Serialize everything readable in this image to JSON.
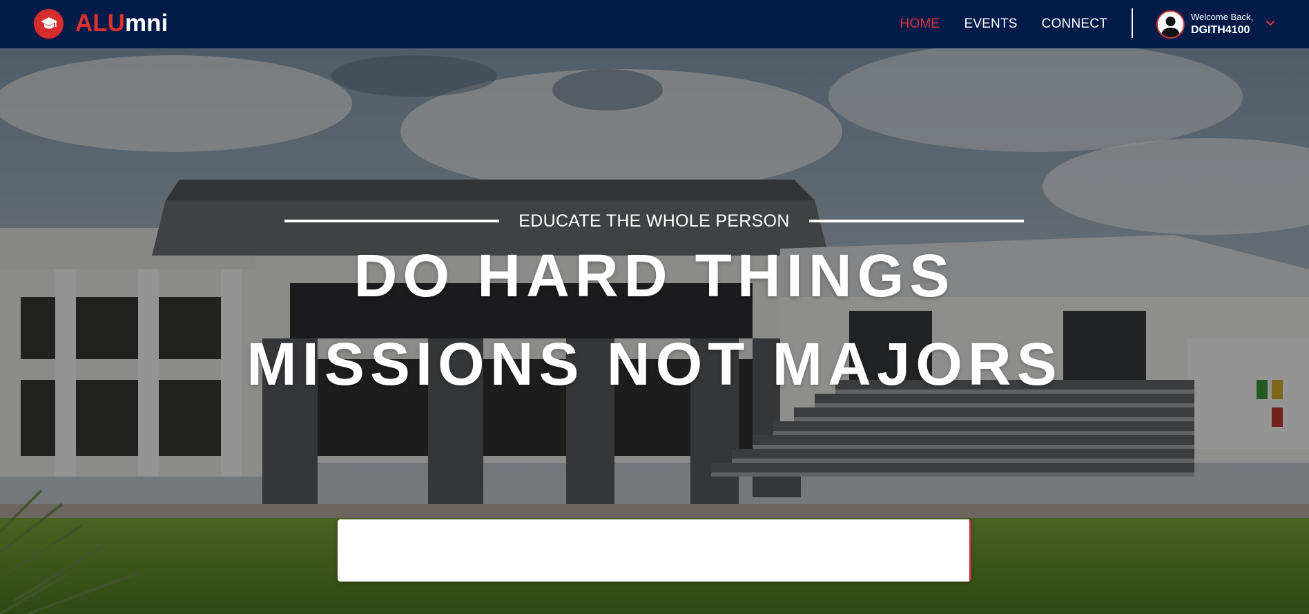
{
  "brand": {
    "logo_icon": "graduation-cap-icon",
    "name_part1": "ALU",
    "name_part2": "mni",
    "accent_color": "#e03131"
  },
  "nav": {
    "items": [
      {
        "label": "HOME",
        "active": true
      },
      {
        "label": "EVENTS",
        "active": false
      },
      {
        "label": "CONNECT",
        "active": false
      }
    ],
    "background_color": "#021b48",
    "active_color": "#d9373f"
  },
  "user": {
    "avatar_icon": "user-avatar-icon",
    "welcome": "Welcome Back,",
    "username": "DGITH4100",
    "menu_icon": "chevron-down-icon"
  },
  "hero": {
    "tagline": "EDUCATE THE WHOLE PERSON",
    "headline_line1": "DO HARD THINGS",
    "headline_line2": "MISSIONS NOT MAJORS",
    "background": "campus-building-photo"
  }
}
